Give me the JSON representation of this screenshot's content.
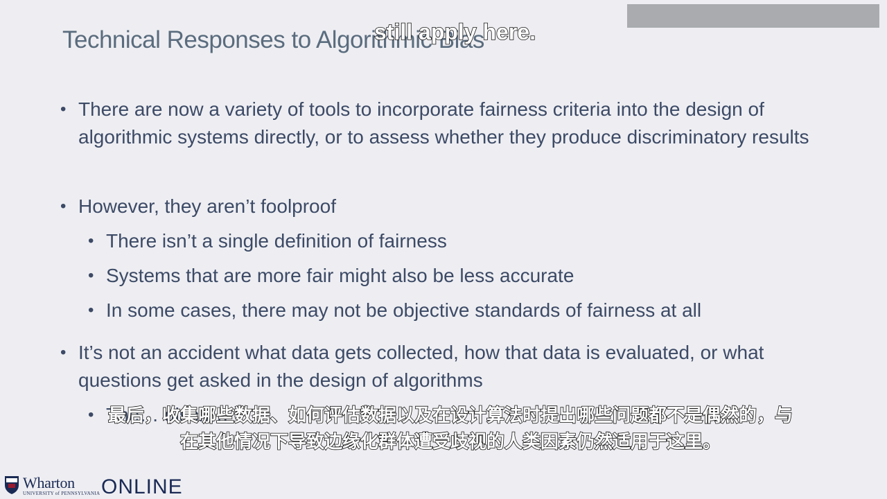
{
  "slide": {
    "title": "Technical Responses to Algorithmic Bias",
    "bullets": [
      {
        "text": "There are now a variety of tools to incorporate fairness criteria into the design of algorithmic systems directly, or to assess whether they produce discriminatory results"
      },
      {
        "text": "However, they aren’t foolproof",
        "sub": [
          "There isn’t a single definition of fairness",
          "Systems that are more fair might also be less accurate",
          "In some cases, there may not be objective standards of fairness at all"
        ]
      },
      {
        "text": "It’s not an accident what data gets collected, how that data is evaluated, or what questions get asked in the design of algorithms",
        "sub": [
          "The… discri…"
        ]
      }
    ]
  },
  "captions": {
    "top_english": "still apply here.",
    "chinese": "最后，收集哪些数据、如何评估数据以及在设计算法时提出哪些问题都不是偶然的，与在其他情况下导致边缘化群体遭受歧视的人类因素仍然适用于这里。"
  },
  "footer": {
    "logo_wharton": "Wharton",
    "logo_sub": "UNIVERSITY of PENNSYLVANIA",
    "logo_online": "ONLINE"
  },
  "colors": {
    "background": "#eeeef2",
    "title": "#5a6c7e",
    "body_text": "#3c4a66",
    "top_box": "#a9abae",
    "logo": "#1a2a55"
  }
}
